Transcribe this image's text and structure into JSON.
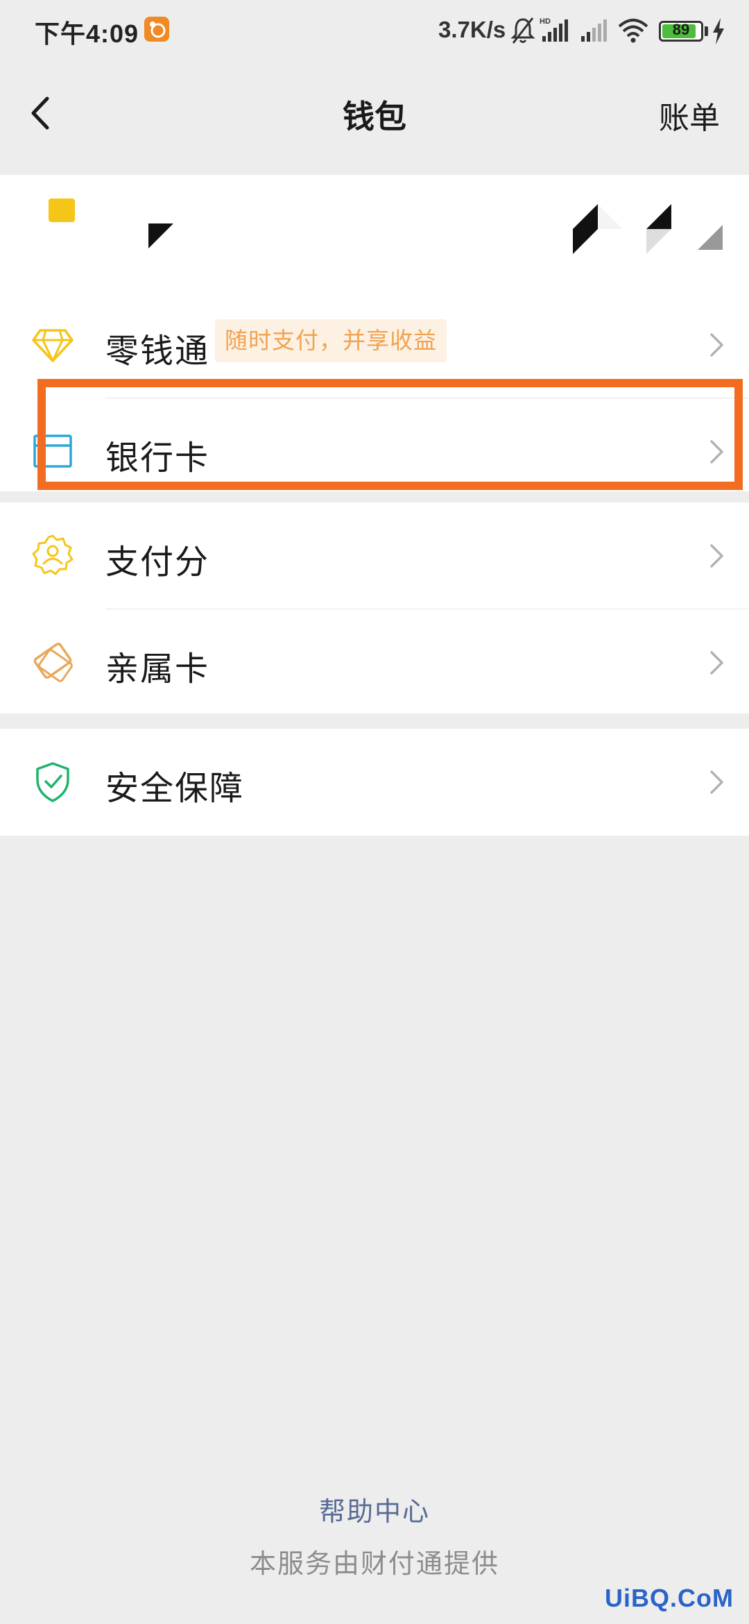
{
  "status_bar": {
    "time": "下午4:09",
    "net_speed": "3.7K/s",
    "battery_level": 89,
    "battery_text": "89",
    "icons": [
      "uc-browser-icon",
      "mute-icon",
      "hd-signal-icon",
      "signal-icon",
      "wifi-icon",
      "battery-icon",
      "charging-icon"
    ]
  },
  "nav": {
    "title": "钱包",
    "right_action": "账单",
    "back_icon": "back-chevron-icon"
  },
  "balance_card": {
    "icon": "wallet-icon",
    "accent": "#f5c518"
  },
  "menu": {
    "lingqiantong": {
      "label": "零钱通",
      "tag": "随时支付，并享收益",
      "icon": "diamond-icon",
      "color": "#f5c518"
    },
    "bank_card": {
      "label": "银行卡",
      "icon": "bank-card-icon",
      "color": "#2aa7d8"
    },
    "pay_score": {
      "label": "支付分",
      "icon": "pay-score-badge-icon",
      "color": "#f5c518"
    },
    "family_card": {
      "label": "亲属卡",
      "icon": "family-card-icon",
      "color": "#e8a85c"
    },
    "security": {
      "label": "安全保障",
      "icon": "shield-check-icon",
      "color": "#1eb36b"
    }
  },
  "highlight": {
    "target": "bank_card",
    "color": "#f26d21"
  },
  "footer": {
    "help": "帮助中心",
    "provider": "本服务由财付通提供"
  },
  "watermark": "UiBQ.CoM"
}
